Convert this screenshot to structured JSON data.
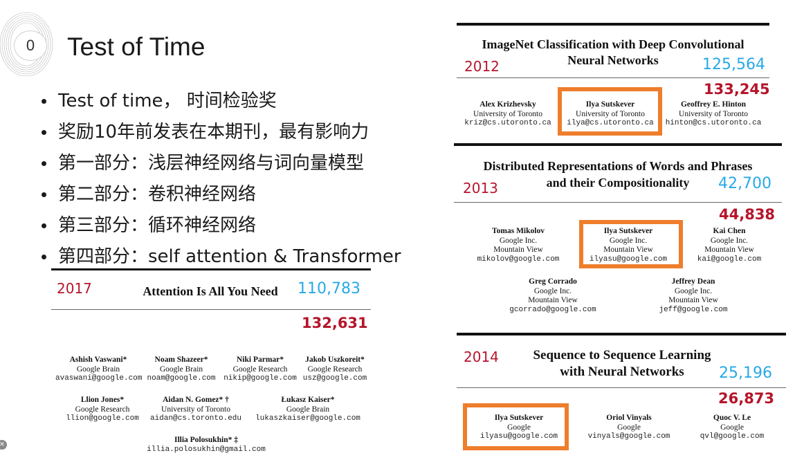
{
  "slide": {
    "number": "0",
    "title": "Test of Time",
    "bullets": [
      "Test of time， 时间检验奖",
      "奖励10年前发表在本期刊，最有影响力",
      "第一部分：浅层神经网络与词向量模型",
      "第二部分：卷积神经网络",
      "第三部分：循环神经网络",
      "第四部分：self attention & Transformer"
    ]
  },
  "papers": {
    "alexnet": {
      "title_line1": "ImageNet Classification with Deep Convolutional",
      "title_line2": "Neural Networks",
      "year": "2012",
      "citations_a": "125,564",
      "citations_b": "133,245",
      "authors": [
        {
          "name": "Alex Krizhevsky",
          "affiliation": "University of Toronto",
          "email": "kriz@cs.utoronto.ca"
        },
        {
          "name": "Ilya Sutskever",
          "affiliation": "University of Toronto",
          "email": "ilya@cs.utoronto.ca"
        },
        {
          "name": "Geoffrey E. Hinton",
          "affiliation": "University of Toronto",
          "email": "hinton@cs.utoronto.ca"
        }
      ]
    },
    "word2vec": {
      "title_line1": "Distributed Representations of Words and Phrases",
      "title_line2": "and their Compositionality",
      "year": "2013",
      "citations_a": "42,700",
      "citations_b": "44,838",
      "authors": [
        {
          "name": "Tomas Mikolov",
          "affiliation": "Google Inc.",
          "location": "Mountain View",
          "email": "mikolov@google.com"
        },
        {
          "name": "Ilya Sutskever",
          "affiliation": "Google Inc.",
          "location": "Mountain View",
          "email": "ilyasu@google.com"
        },
        {
          "name": "Kai Chen",
          "affiliation": "Google Inc.",
          "location": "Mountain View",
          "email": "kai@google.com"
        },
        {
          "name": "Greg Corrado",
          "affiliation": "Google Inc.",
          "location": "Mountain View",
          "email": "gcorrado@google.com"
        },
        {
          "name": "Jeffrey Dean",
          "affiliation": "Google Inc.",
          "location": "Mountain View",
          "email": "jeff@google.com"
        }
      ]
    },
    "seq2seq": {
      "title_line1": "Sequence to Sequence Learning",
      "title_line2": "with Neural Networks",
      "year": "2014",
      "citations_a": "25,196",
      "citations_b": "26,873",
      "authors": [
        {
          "name": "Ilya Sutskever",
          "affiliation": "Google",
          "email": "ilyasu@google.com"
        },
        {
          "name": "Oriol Vinyals",
          "affiliation": "Google",
          "email": "vinyals@google.com"
        },
        {
          "name": "Quoc V. Le",
          "affiliation": "Google",
          "email": "qvl@google.com"
        }
      ]
    },
    "transformer": {
      "title": "Attention Is All You Need",
      "year": "2017",
      "citations_a": "110,783",
      "citations_b": "132,631",
      "authors": [
        {
          "name": "Ashish Vaswani*",
          "affiliation": "Google Brain",
          "email": "avaswani@google.com"
        },
        {
          "name": "Noam Shazeer*",
          "affiliation": "Google Brain",
          "email": "noam@google.com"
        },
        {
          "name": "Niki Parmar*",
          "affiliation": "Google Research",
          "email": "nikip@google.com"
        },
        {
          "name": "Jakob Uszkoreit*",
          "affiliation": "Google Research",
          "email": "usz@google.com"
        },
        {
          "name": "Llion Jones*",
          "affiliation": "Google Research",
          "email": "llion@google.com"
        },
        {
          "name": "Aidan N. Gomez* †",
          "affiliation": "University of Toronto",
          "email": "aidan@cs.toronto.edu"
        },
        {
          "name": "Łukasz Kaiser*",
          "affiliation": "Google Brain",
          "email": "lukaszkaiser@google.com"
        },
        {
          "name": "Illia Polosukhin* ‡",
          "email": "illia.polosukhin@gmail.com"
        }
      ]
    }
  },
  "colors": {
    "highlight": "#ee7d2c",
    "year": "#b5152b",
    "citation_blue": "#27a9e6"
  },
  "icons": {
    "corner": "close-icon",
    "swirl": "decorative-swirl-icon"
  }
}
